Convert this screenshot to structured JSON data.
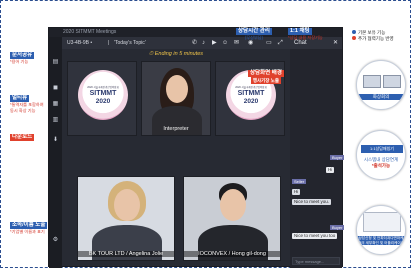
{
  "app": {
    "window_title": "2020 SITMMT Meetings",
    "toolbar": {
      "meeting_id": "U3-4B-9B •",
      "separator": "|",
      "title": "'Today's Topic'"
    },
    "chat_header": "Chat",
    "notice": "⏱ Ending in 5 minutes",
    "tiles": [
      {
        "label": "",
        "logo": {
          "sub": "2020 서울국제관광산업박람회",
          "main": "SITMMT",
          "year": "2020"
        }
      },
      {
        "label": "Interpreter"
      },
      {
        "label": "",
        "logo": {
          "sub": "2020 서울국제관광산업박람회",
          "main": "SITMMT",
          "year": "2020"
        }
      },
      {
        "label": "BK TOUR LTD / Angelina Jolie"
      },
      {
        "label": "IOCONVEX / Hong gil-dong"
      }
    ],
    "chat": {
      "messages": [
        {
          "sender": "Seller",
          "text": "Hi"
        },
        {
          "sender": "",
          "text": "Hi"
        },
        {
          "sender": "",
          "text": "Nice to meet you."
        },
        {
          "sender": "",
          "text": "Nice to meet you too"
        }
      ],
      "tag_a": "Buyer",
      "tag_b": "Buyer",
      "input_placeholder": "Type message..."
    }
  },
  "annotations": {
    "share": {
      "title": "문서공유",
      "note": "*용어 기능"
    },
    "multiview": {
      "title": "멀티뷰",
      "note": "*통역자를 포함하여\n동시 화상 기능"
    },
    "download": {
      "title": "다운로드"
    },
    "identity": {
      "title": "소속/이름 노출",
      "note": "*기업별 이름과 표기"
    },
    "timer": {
      "title": "상담시간 관리",
      "note": "(무상부담)"
    },
    "chat": {
      "title": "1:1 채팅",
      "note": "*상담 내용 저장기능"
    },
    "background": {
      "title": "상담화면 배경",
      "note": "행사기장 노출"
    }
  },
  "legend": {
    "items": [
      {
        "text": "기본 보유 기능",
        "color": "#2d5fb0"
      },
      {
        "text": "추가 협력기능 반영",
        "color": "#e0412c"
      }
    ]
  },
  "features": [
    {
      "label": "화상회의"
    },
    {
      "title": "1:1상담매칭기",
      "label": "시스템내 상담연계",
      "note": "*출석가능"
    },
    {
      "label": "상담신청 및 언파더과다변마케팅의 세부확인 및 어플리케이션"
    }
  ],
  "colors": {
    "accent_blue": "#2d5fb0",
    "accent_red": "#e0412c",
    "window_bg": "#272a33",
    "notice": "#f0c44a"
  }
}
